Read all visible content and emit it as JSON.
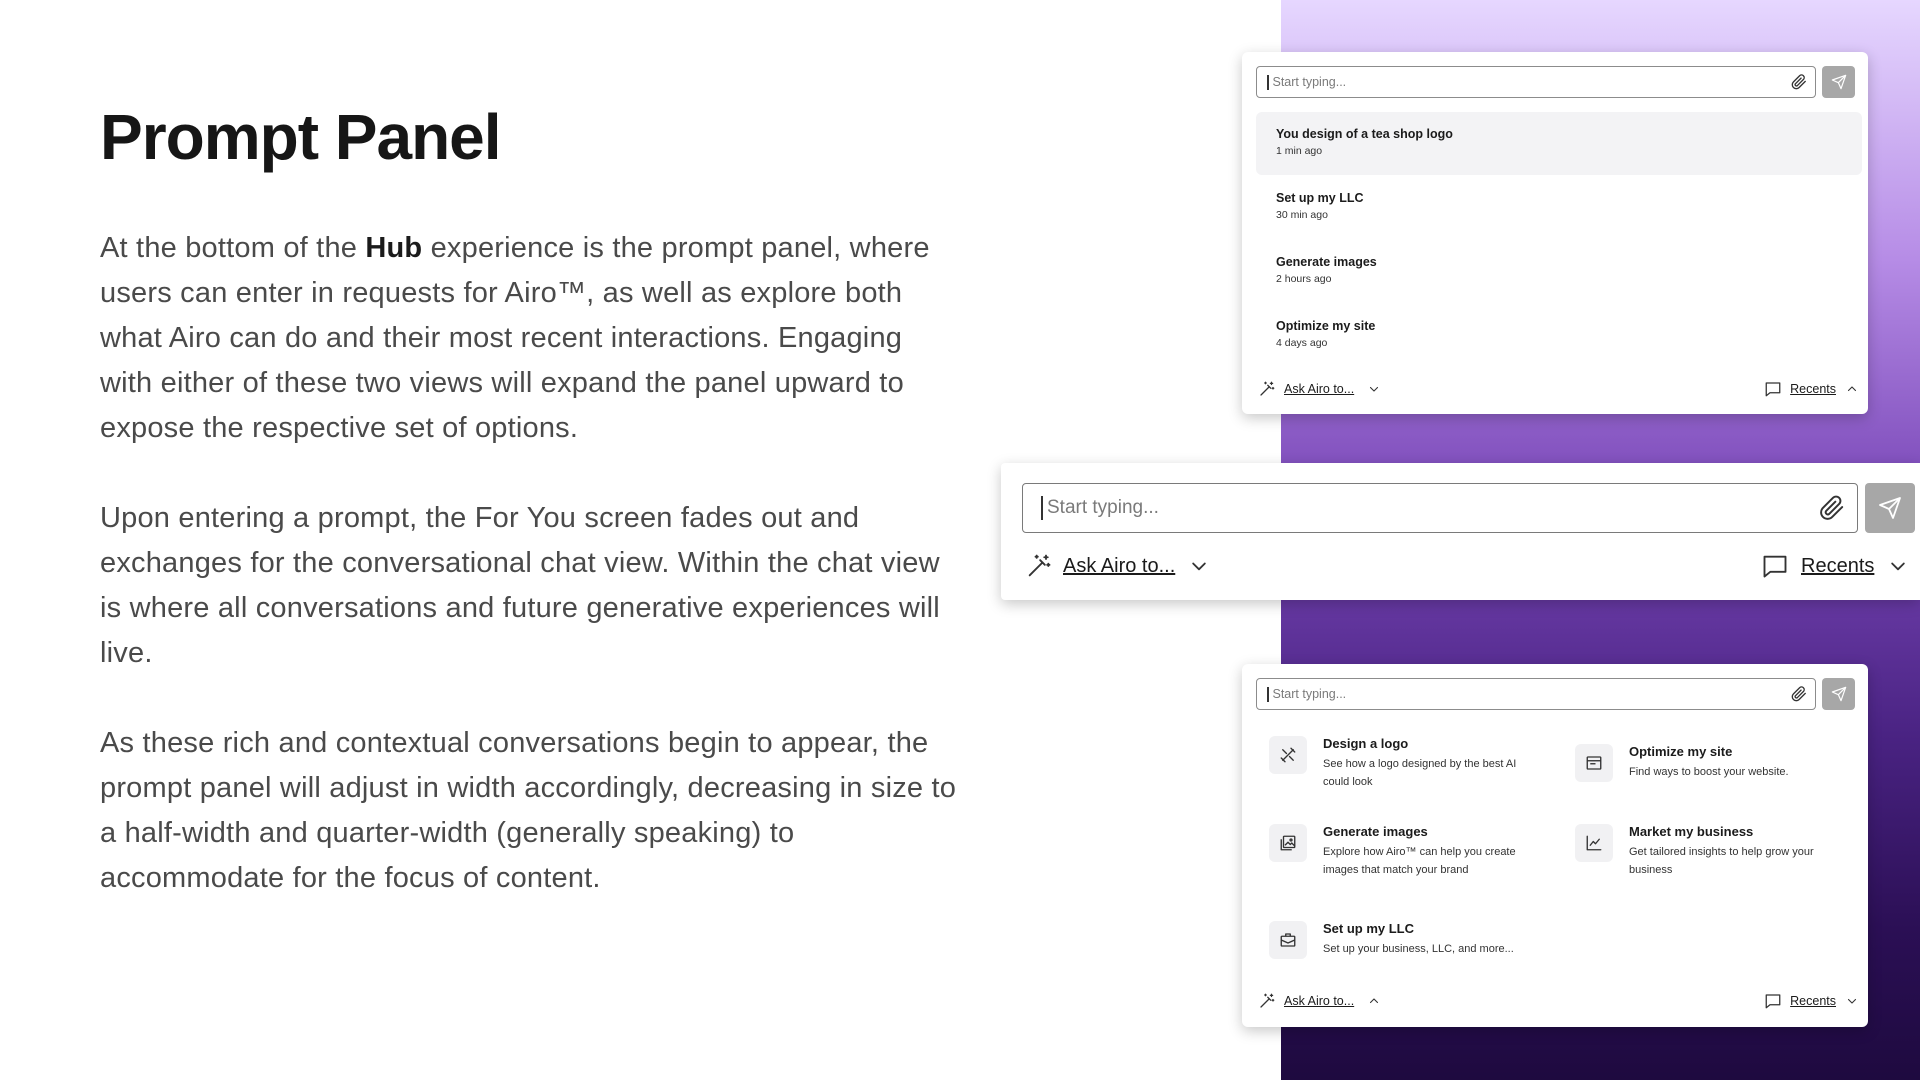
{
  "page": {
    "title": "Prompt Panel",
    "p1_before": "At the bottom of the ",
    "p1_bold": "Hub",
    "p1_after": " experience is the prompt panel, where users can enter in requests for Airo™, as well as explore both what Airo can do and their most recent interactions. Engaging with either of these two views will expand the panel upward to expose the respective set of options.",
    "p2": "Upon entering a prompt, the For You screen fades out and exchanges for the conversational chat view. Within the chat view is where all conversations and future generative experiences will live.",
    "p3": "As these rich and contextual conversations begin to appear, the prompt panel will adjust in width accordingly, decreasing in size to a half-width and quarter-width (generally speaking) to accommodate for the focus of content."
  },
  "colors": {
    "gradient_top": "#e6d7ff",
    "gradient_bottom": "#1e0a3f",
    "send_button": "#a7a7a7"
  },
  "panel_recents": {
    "placeholder": "Start typing...",
    "items": [
      {
        "title": "You design of a tea shop logo",
        "time": "1 min ago"
      },
      {
        "title": "Set up my LLC",
        "time": "30 min ago"
      },
      {
        "title": "Generate images",
        "time": "2 hours ago"
      },
      {
        "title": "Optimize my site",
        "time": "4 days ago"
      }
    ],
    "ask_label": "Ask Airo to...",
    "recents_label": "Recents"
  },
  "panel_collapsed": {
    "placeholder": "Start typing...",
    "ask_label": "Ask Airo to...",
    "recents_label": "Recents"
  },
  "panel_ask": {
    "placeholder": "Start typing...",
    "tiles": [
      {
        "title": "Design a logo",
        "desc": "See how a logo designed by the best AI could look",
        "icon": "pen-tool-icon"
      },
      {
        "title": "Optimize my site",
        "desc": "Find ways to boost your website.",
        "icon": "browser-window-icon"
      },
      {
        "title": "Generate images",
        "desc": "Explore how Airo™ can help you create images that match your brand",
        "icon": "image-icon"
      },
      {
        "title": "Market my business",
        "desc": "Get tailored insights to help grow your business",
        "icon": "line-chart-icon"
      },
      {
        "title": "Set up my LLC",
        "desc": "Set up your business, LLC, and more...",
        "icon": "briefcase-icon"
      }
    ],
    "ask_label": "Ask Airo to...",
    "recents_label": "Recents"
  }
}
